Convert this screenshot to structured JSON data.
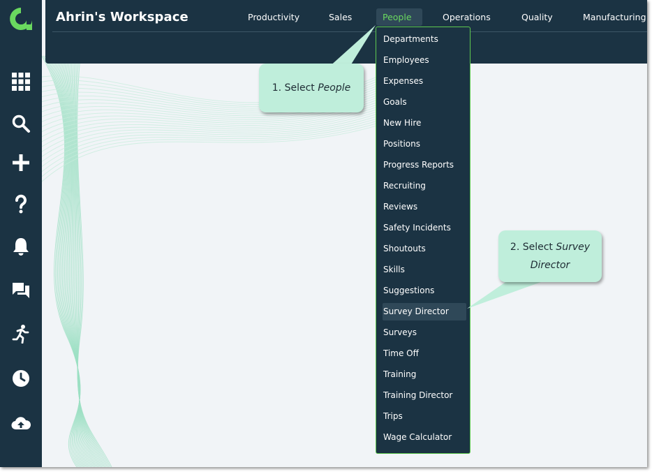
{
  "header": {
    "workspace_title": "Ahrin's Workspace",
    "nav": [
      {
        "label": "Productivity"
      },
      {
        "label": "Sales"
      },
      {
        "label": "People",
        "active": true
      },
      {
        "label": "Operations"
      },
      {
        "label": "Quality"
      },
      {
        "label": "Manufacturing"
      }
    ]
  },
  "sidebar": {
    "icons": [
      "apps-grid-icon",
      "search-icon",
      "plus-icon",
      "help-icon",
      "bell-icon",
      "chat-icon",
      "running-person-icon",
      "clock-icon",
      "cloud-upload-icon"
    ]
  },
  "dropdown": {
    "items": [
      "Departments",
      "Employees",
      "Expenses",
      "Goals",
      "New Hire",
      "Positions",
      "Progress Reports",
      "Recruiting",
      "Reviews",
      "Safety Incidents",
      "Shoutouts",
      "Skills",
      "Suggestions",
      "Survey Director",
      "Surveys",
      "Time Off",
      "Training",
      "Training Director",
      "Trips",
      "Wage Calculator"
    ],
    "highlighted": "Survey Director"
  },
  "callouts": {
    "step1": {
      "prefix": "1. Select ",
      "emphasis": "People"
    },
    "step2": {
      "prefix": "2. Select ",
      "emphasis_1": "Survey",
      "emphasis_2": "Director"
    }
  },
  "colors": {
    "navy": "#1b3343",
    "accent_green": "#6ad95f",
    "callout_mint": "#bfeedb",
    "background": "#f1f4f7"
  }
}
